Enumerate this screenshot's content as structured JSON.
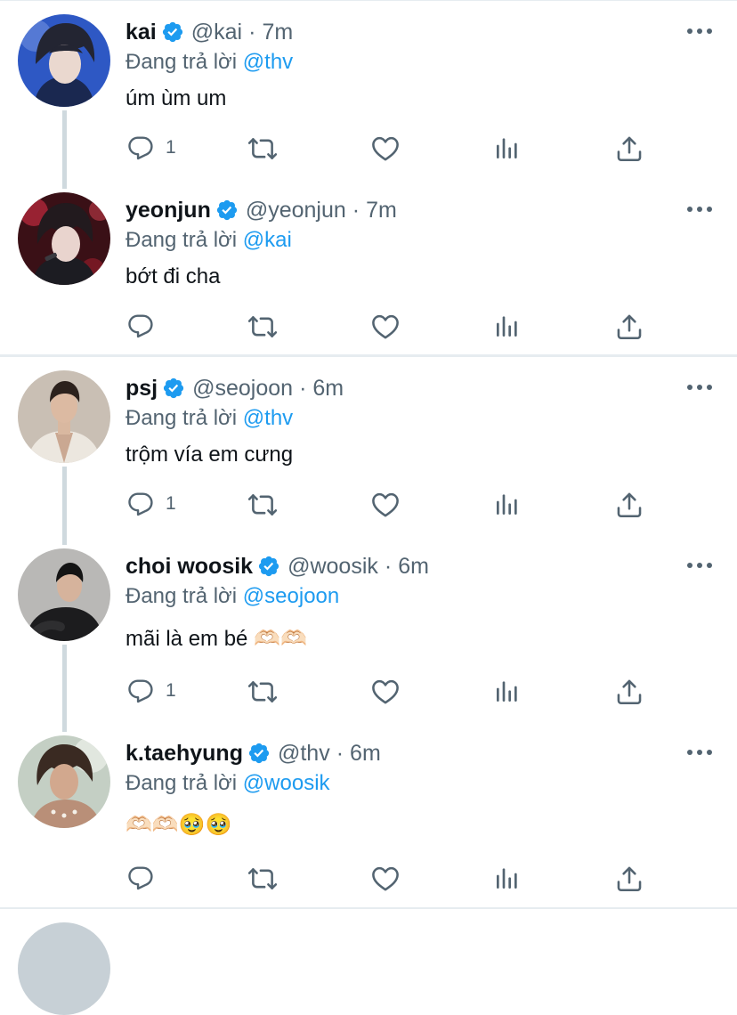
{
  "tweets": [
    {
      "display_name": "kai",
      "handle": "@kai",
      "separator": "·",
      "time": "7m",
      "reply_prefix": "Đang trả lời",
      "reply_to": "@thv",
      "text": "úm ùm um",
      "reply_count": "1",
      "avatar_icon": "avatar-kai"
    },
    {
      "display_name": "yeonjun",
      "handle": "@yeonjun",
      "separator": "·",
      "time": "7m",
      "reply_prefix": "Đang trả lời",
      "reply_to": "@kai",
      "text": "bớt đi cha",
      "reply_count": "",
      "avatar_icon": "avatar-yeonjun"
    },
    {
      "display_name": "psj",
      "handle": "@seojoon",
      "separator": "·",
      "time": "6m",
      "reply_prefix": "Đang trả lời",
      "reply_to": "@thv",
      "text": "trộm vía em cưng",
      "reply_count": "1",
      "avatar_icon": "avatar-psj"
    },
    {
      "display_name": "choi woosik",
      "handle": "@woosik",
      "separator": "·",
      "time": "6m",
      "reply_prefix": "Đang trả lời",
      "reply_to": "@seojoon",
      "text": "mãi là em bé 🫶🏻🫶🏻",
      "reply_count": "1",
      "avatar_icon": "avatar-woosik"
    },
    {
      "display_name": "k.taehyung",
      "handle": "@thv",
      "separator": "·",
      "time": "6m",
      "reply_prefix": "Đang trả lời",
      "reply_to": "@woosik",
      "text": "🫶🏻🫶🏻🥹🥹",
      "reply_count": "",
      "avatar_icon": "avatar-taehyung"
    }
  ],
  "icons": {
    "verified": "verified-badge-icon",
    "more": "more-options-icon",
    "reply": "reply-icon",
    "retweet": "retweet-icon",
    "like": "heart-icon",
    "views": "analytics-icon",
    "share": "share-icon"
  },
  "colors": {
    "accent": "#1d9bf0",
    "secondary_text": "#536471",
    "primary_text": "#0f1419",
    "separator": "#e6ecf0"
  }
}
